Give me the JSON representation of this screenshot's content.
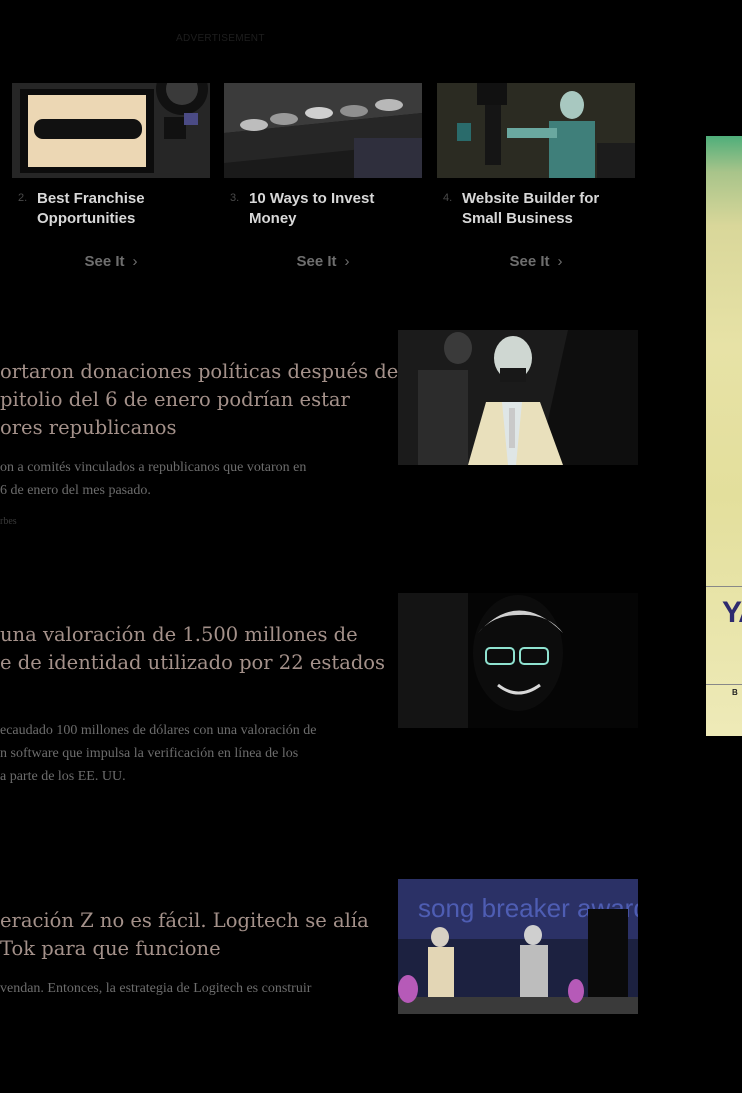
{
  "ad_label": "ADVERTISEMENT",
  "sponsored": [
    {
      "number": "2.",
      "title": "Best Franchise Opportunities",
      "cta": "See It",
      "cta_icon": "chevron-right-icon"
    },
    {
      "number": "3.",
      "title": "10 Ways to Invest Money",
      "cta": "See It",
      "cta_icon": "chevron-right-icon"
    },
    {
      "number": "4.",
      "title": "Website Builder for Small Business",
      "cta": "See It",
      "cta_icon": "chevron-right-icon"
    }
  ],
  "articles": [
    {
      "headline_lines": [
        "ortaron donaciones políticas después de",
        "pitolio del 6 de enero podrían estar",
        "ores republicanos"
      ],
      "summary_lines": [
        "on a comités vinculados a republicanos que votaron en",
        "6 de enero del mes pasado."
      ],
      "byline": "rbes"
    },
    {
      "headline_lines": [
        "una valoración de 1.500 millones de",
        "e de identidad utilizado por 22 estados"
      ],
      "summary_lines": [
        "ecaudado 100 millones de dólares con una valoración de",
        "n software que impulsa la verificación en línea de los",
        "a parte de los EE. UU."
      ]
    },
    {
      "headline_lines": [
        "eración Z no es fácil. Logitech se alía",
        "Tok para que funcione"
      ],
      "summary_lines": [
        " vendan. Entonces, la estrategia de Logitech es construir"
      ],
      "image_text": "song breaker awards"
    }
  ],
  "side_ad": {
    "text": "YA",
    "small": "B"
  },
  "colors": {
    "background": "#000000",
    "headline": "#a4918a",
    "summary": "#6d6d6d",
    "sponsor_title": "#d8d8d8"
  }
}
